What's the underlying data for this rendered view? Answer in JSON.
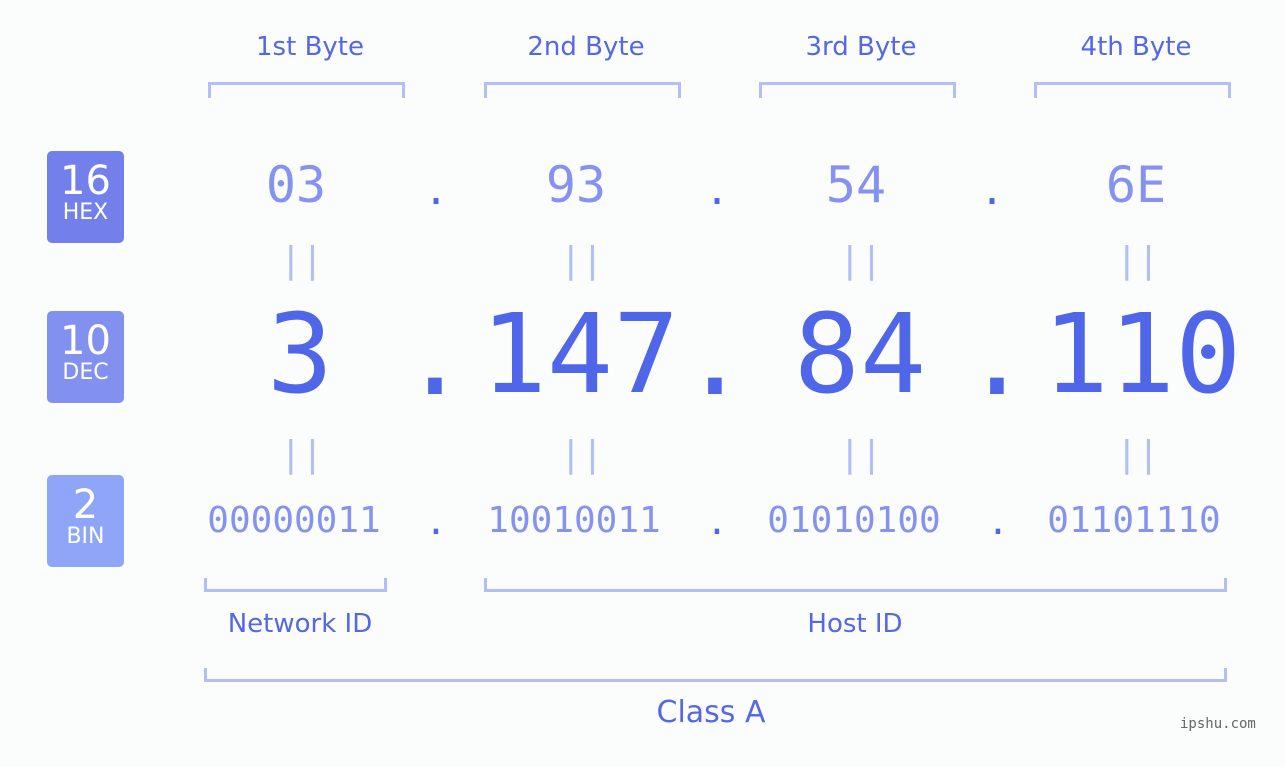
{
  "badges": [
    {
      "num": "16",
      "label": "HEX",
      "color": "#7380ec"
    },
    {
      "num": "10",
      "label": "DEC",
      "color": "#8290f0"
    },
    {
      "num": "2",
      "label": "BIN",
      "color": "#8fa6f8"
    }
  ],
  "byte_headers": [
    "1st Byte",
    "2nd Byte",
    "3rd Byte",
    "4th Byte"
  ],
  "hex": [
    "03",
    "93",
    "54",
    "6E"
  ],
  "dec": [
    "3",
    "147",
    "84",
    "110"
  ],
  "bin": [
    "00000011",
    "10010011",
    "01010100",
    "01101110"
  ],
  "separator": ".",
  "equals": "||",
  "labels": {
    "network": "Network ID",
    "host": "Host ID",
    "class": "Class A"
  },
  "watermark": "ipshu.com"
}
